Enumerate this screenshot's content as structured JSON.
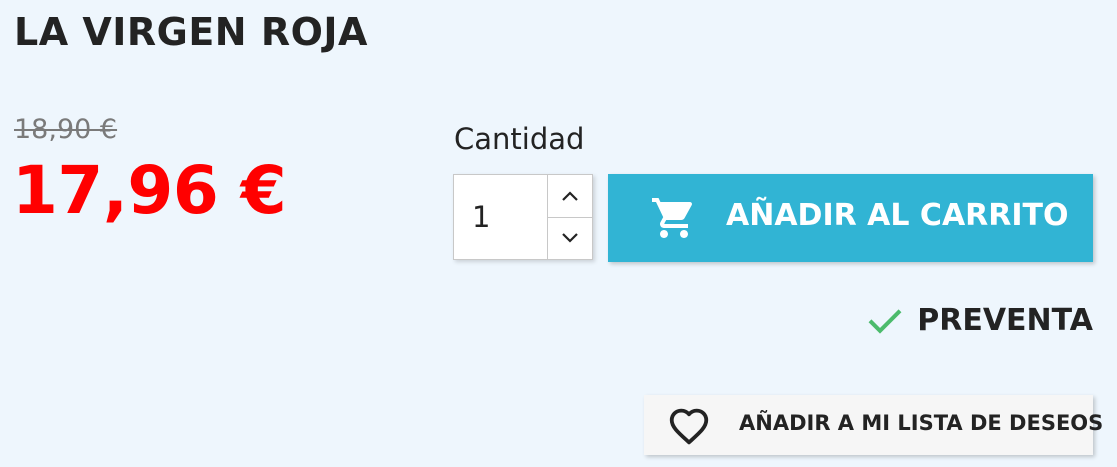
{
  "product": {
    "title": "LA VIRGEN ROJA",
    "old_price": "18,90 €",
    "price": "17,96 €"
  },
  "quantity": {
    "label": "Cantidad",
    "value": "1",
    "increment_icon": "chevron-up-icon",
    "decrement_icon": "chevron-down-icon"
  },
  "cart": {
    "label": "AÑADIR AL CARRITO",
    "icon": "cart-icon",
    "color": "#31b4d4"
  },
  "availability": {
    "icon": "check-icon",
    "icon_color": "#4cbb6c",
    "status": "PREVENTA"
  },
  "wishlist": {
    "label": "AÑADIR A MI LISTA DE DESEOS",
    "icon": "heart-icon"
  },
  "colors": {
    "background": "#eef6fd",
    "price": "#ff0000",
    "old_price": "#7a7a7a",
    "text": "#232323"
  }
}
